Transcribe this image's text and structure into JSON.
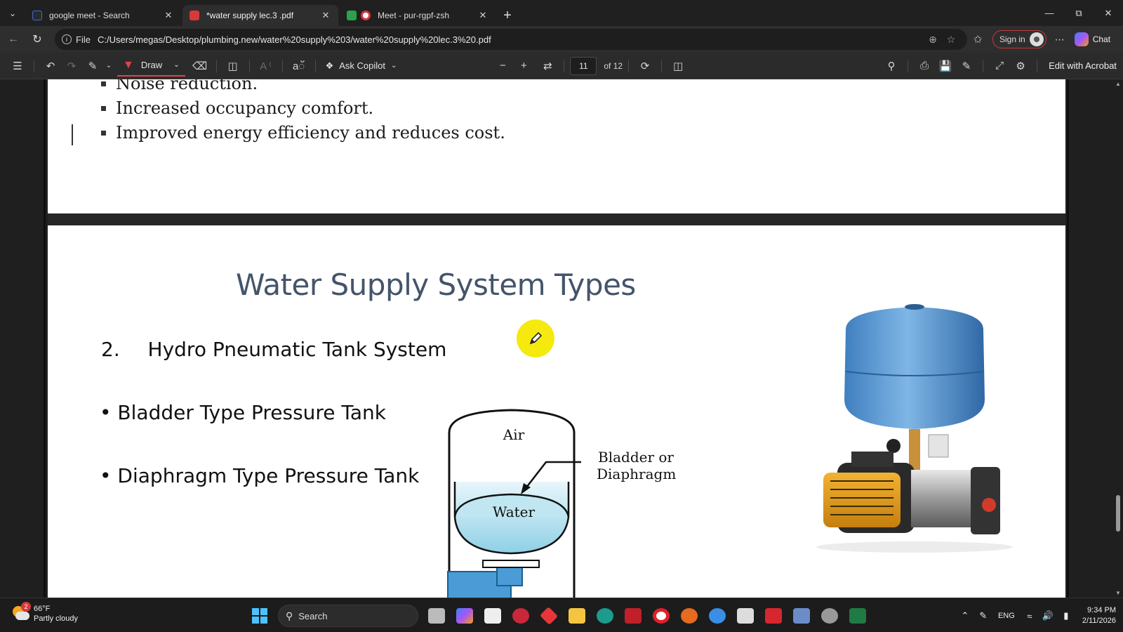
{
  "browser": {
    "tabs": [
      {
        "title": "google meet - Search",
        "icon": "search-favicon",
        "color": "#3c6fd6",
        "active": false
      },
      {
        "title": "*water supply lec.3 .pdf",
        "icon": "pdf-favicon",
        "color": "#d93838",
        "active": true
      },
      {
        "title": "Meet - pur-rgpf-zsh",
        "icon": "meet-favicon",
        "color": "#2ba24c",
        "active": false
      }
    ],
    "address": {
      "scheme": "File",
      "url": "C:/Users/megas/Desktop/plumbing.new/water%20supply%203/water%20supply%20lec.3%20.pdf"
    },
    "signin_label": "Sign in",
    "chat_label": "Chat"
  },
  "pdf_toolbar": {
    "draw_label": "Draw",
    "ask_copilot_label": "Ask Copilot",
    "current_page": "11",
    "page_total_label": "of 12",
    "edit_acrobat_label": "Edit with Acrobat"
  },
  "page_prev": {
    "bullets": [
      "Noise reduction.",
      "Increased occupancy comfort.",
      "Improved energy efficiency and reduces cost."
    ]
  },
  "slide": {
    "title": "Water Supply System Types",
    "heading_number": "2.",
    "heading_text": "Hydro Pneumatic Tank System",
    "bullets": [
      "Bladder Type Pressure Tank",
      "Diaphragm Type Pressure Tank"
    ],
    "diagram": {
      "top_label": "Air",
      "bottom_label": "Water",
      "callout_line1": "Bladder or",
      "callout_line2": "Diaphragm"
    }
  },
  "taskbar": {
    "weather_temp": "66°F",
    "weather_desc": "Partly cloudy",
    "weather_badge": "2",
    "search_label": "Search",
    "language": "ENG",
    "time": "9:34 PM",
    "date": "2/11/2026"
  }
}
